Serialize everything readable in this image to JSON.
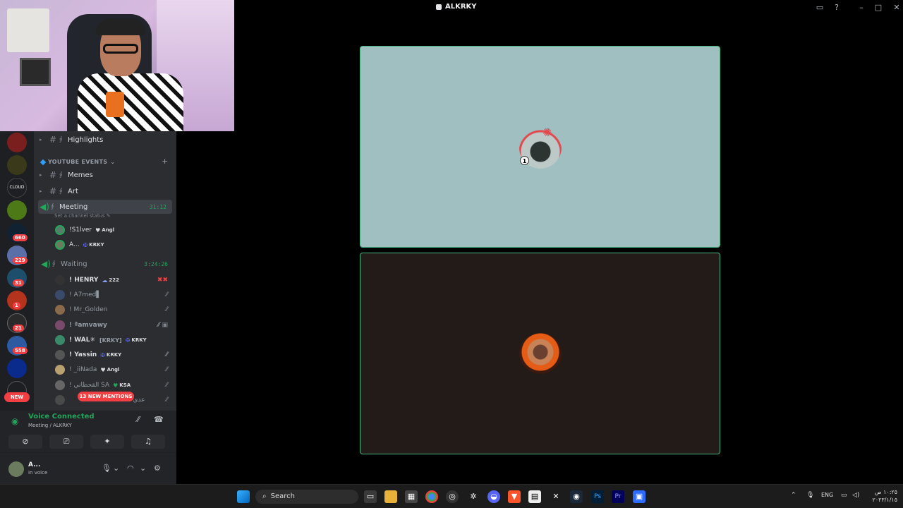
{
  "window": {
    "title": "ALKRKY"
  },
  "channels": {
    "category": "YOUTUBE EVENTS",
    "items": [
      {
        "name": "Highlights"
      },
      {
        "name": "Memes"
      },
      {
        "name": "Art"
      }
    ],
    "meeting": {
      "name": "Meeting",
      "time": "31:12",
      "status_placeholder": "Set a channel status",
      "users": [
        {
          "name": "!S1lver",
          "tag": "Angl",
          "tag_icon": "heart-icon"
        },
        {
          "name": "A...",
          "tag": "KRKY",
          "tag_icon": "shield-icon"
        }
      ]
    },
    "waiting": {
      "name": "Waiting",
      "time": "3:24:26",
      "users": [
        {
          "name": "! HENRY",
          "tag": "222"
        },
        {
          "name": "! A7med▌"
        },
        {
          "name": "! Mr_Golden"
        },
        {
          "name": "! ªamvawy"
        },
        {
          "name": "! WAL✳",
          "extra": "[KRKY]",
          "tag": "KRKY"
        },
        {
          "name": "! Yassin",
          "tag": "KRKY"
        },
        {
          "name": "! _iiNada",
          "tag": "Angl"
        },
        {
          "name": "! القحطاني SA",
          "tag": "KSA"
        },
        {
          "name": "! عدي"
        }
      ]
    },
    "mentions_pill": "13 NEW MENTIONS"
  },
  "servers": {
    "badges": [
      "1",
      "660",
      "229",
      "31",
      "1",
      "21",
      "558"
    ],
    "new_label": "NEW"
  },
  "voice": {
    "title": "Voice Connected",
    "subtitle": "Meeting / ALKRKY"
  },
  "user_panel": {
    "name": "A...",
    "status": "In voice"
  },
  "taskbar": {
    "search_label": "Search",
    "lang": "ENG",
    "time": "١٠:٢٥ ص",
    "date": "٢٠٢٣/١/١٥"
  },
  "colors": {
    "speaking_border": "#43b581",
    "voice_green": "#23a55a",
    "danger_red": "#f23f43",
    "tile1_bg": "#9fbfc1",
    "tile2_bg": "#231b17"
  }
}
